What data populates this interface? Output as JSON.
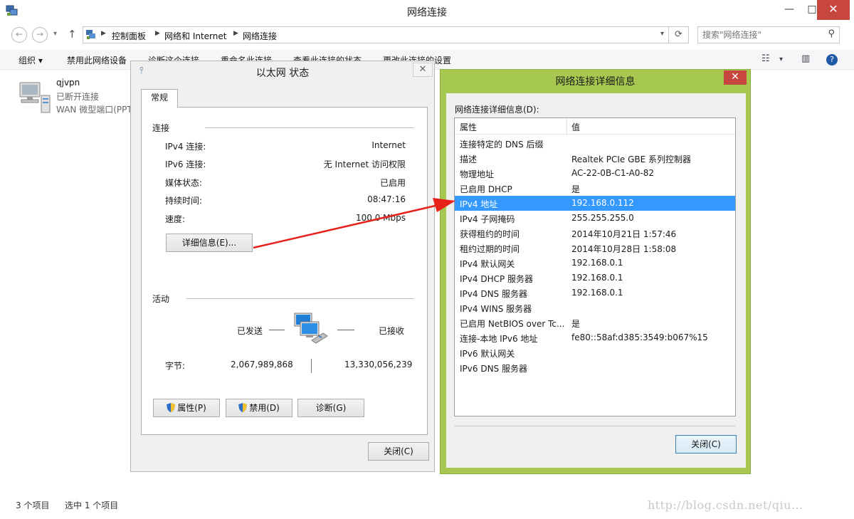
{
  "window": {
    "title": "网络连接",
    "min": "—",
    "max": "□",
    "close": "✕"
  },
  "nav": {
    "breadcrumbs": [
      "控制面板",
      "网络和 Internet",
      "网络连接"
    ],
    "search_placeholder": "搜索\"网络连接\""
  },
  "toolbar": {
    "items": [
      "组织 ▾",
      "禁用此网络设备",
      "诊断这个连接",
      "重命名此连接",
      "查看此连接的状态",
      "更改此连接的设置"
    ]
  },
  "file_item": {
    "name": "qjvpn",
    "status": "已断开连接",
    "device": "WAN 微型端口(PPTP)"
  },
  "statusbar": {
    "count": "3 个项目",
    "selected": "选中 1 个项目",
    "watermark": "http://blog.csdn.net/qiu..."
  },
  "status_dialog": {
    "title": "以太网 状态",
    "tab": "常规",
    "connection_group": "连接",
    "rows": [
      {
        "key": "IPv4 连接:",
        "value": "Internet"
      },
      {
        "key": "IPv6 连接:",
        "value": "无 Internet 访问权限"
      },
      {
        "key": "媒体状态:",
        "value": "已启用"
      },
      {
        "key": "持续时间:",
        "value": "08:47:16"
      },
      {
        "key": "速度:",
        "value": "100.0 Mbps"
      }
    ],
    "details_button": "详细信息(E)...",
    "activity_group": "活动",
    "sent_label": "已发送",
    "received_label": "已接收",
    "bytes_label": "字节:",
    "bytes_sent": "2,067,989,868",
    "bytes_received": "13,330,056,239",
    "properties_button": "属性(P)",
    "disable_button": "禁用(D)",
    "diagnose_button": "诊断(G)",
    "close_button": "关闭(C)"
  },
  "details_dialog": {
    "title": "网络连接详细信息",
    "list_label": "网络连接详细信息(D):",
    "col_property": "属性",
    "col_value": "值",
    "rows": [
      {
        "p": "连接特定的 DNS 后缀",
        "v": ""
      },
      {
        "p": "描述",
        "v": "Realtek PCIe GBE 系列控制器"
      },
      {
        "p": "物理地址",
        "v": "AC-22-0B-C1-A0-82"
      },
      {
        "p": "已启用 DHCP",
        "v": "是"
      },
      {
        "p": "IPv4 地址",
        "v": "192.168.0.112"
      },
      {
        "p": "IPv4 子网掩码",
        "v": "255.255.255.0"
      },
      {
        "p": "获得租约的时间",
        "v": "2014年10月21日 1:57:46"
      },
      {
        "p": "租约过期的时间",
        "v": "2014年10月28日 1:58:08"
      },
      {
        "p": "IPv4 默认网关",
        "v": "192.168.0.1"
      },
      {
        "p": "IPv4 DHCP 服务器",
        "v": "192.168.0.1"
      },
      {
        "p": "IPv4 DNS 服务器",
        "v": "192.168.0.1"
      },
      {
        "p": "IPv4 WINS 服务器",
        "v": ""
      },
      {
        "p": "已启用 NetBIOS over Tc...",
        "v": "是"
      },
      {
        "p": "连接-本地 IPv6 地址",
        "v": "fe80::58af:d385:3549:b067%15"
      },
      {
        "p": "IPv6 默认网关",
        "v": ""
      },
      {
        "p": "IPv6 DNS 服务器",
        "v": ""
      }
    ],
    "selected_index": 4,
    "close_button": "关闭(C)",
    "close_x": "✕"
  },
  "icons": {
    "app": "network-connections-icon",
    "shield": "uac-shield-icon",
    "network": "network-computers-icon"
  },
  "colors": {
    "selection": "#3399ff",
    "details_frame": "#a7c850",
    "close_red": "#c7463e",
    "arrow": "#e8211b"
  }
}
